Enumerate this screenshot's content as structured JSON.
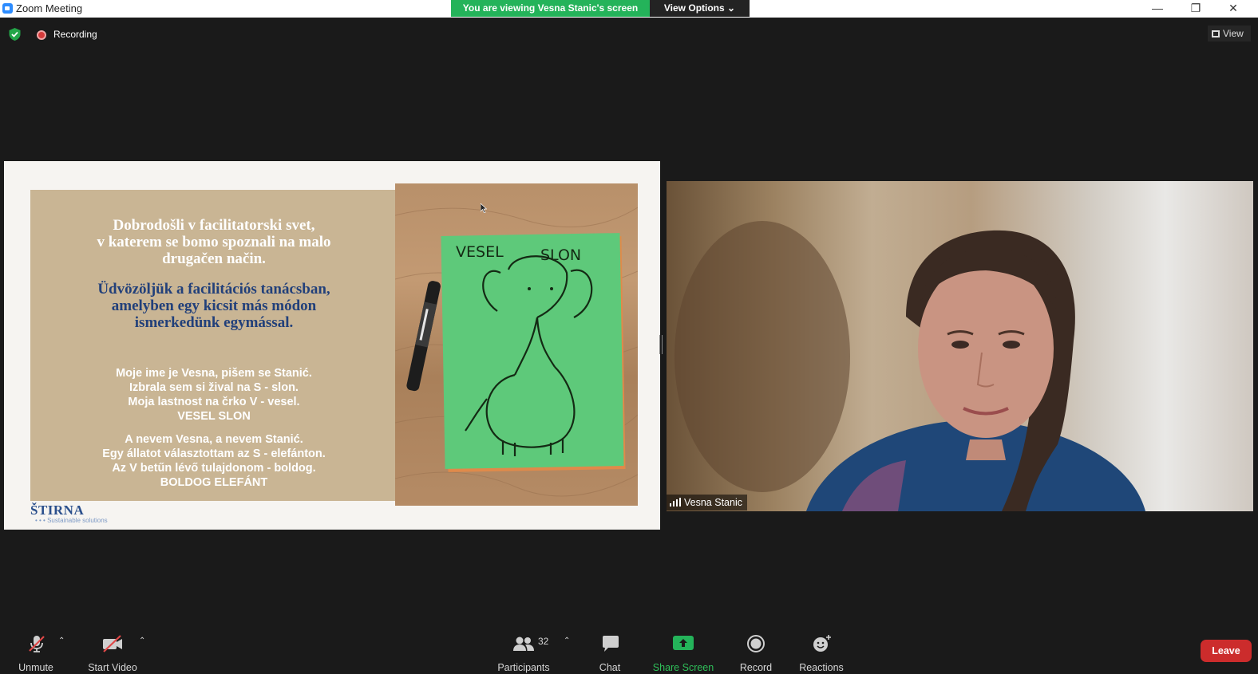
{
  "window": {
    "title": "Zoom Meeting"
  },
  "banner": {
    "viewing": "You are viewing Vesna Stanic's screen",
    "view_options": "View Options"
  },
  "status": {
    "recording": "Recording",
    "view": "View"
  },
  "slide": {
    "heading_slo": [
      "Dobrodošli v facilitatorski svet,",
      "v katerem se bomo spoznali na malo",
      "drugačen način."
    ],
    "heading_hu": [
      "Üdvözöljük a facilitációs tanácsban,",
      "amelyben egy kicsit más módon",
      "ismerkedünk egymással."
    ],
    "para_slo": [
      "Moje ime je Vesna, pišem se Stanić.",
      "Izbrala sem si žival na S - slon.",
      "Moja lastnost na črko V - vesel.",
      "VESEL SLON"
    ],
    "para_hu": [
      "A nevem Vesna, a nevem Stanić.",
      "Egy állatot választottam az S - elefánton.",
      "Az V betűn lévő tulajdonom - boldog.",
      "BOLDOG ELEFÁNT"
    ],
    "logo_name": "ŠTIRNA",
    "logo_tagline": "Sustainable solutions",
    "card_text_left": "VESEL",
    "card_text_right": "SLON"
  },
  "participant": {
    "name": "Vesna Stanic"
  },
  "toolbar": {
    "unmute": "Unmute",
    "start_video": "Start Video",
    "participants": "Participants",
    "participants_count": "32",
    "chat": "Chat",
    "share_screen": "Share Screen",
    "record": "Record",
    "reactions": "Reactions",
    "leave": "Leave"
  },
  "colors": {
    "share_green": "#24b35a",
    "leave_red": "#cc2c2c",
    "zoom_blue": "#2d8cff"
  }
}
